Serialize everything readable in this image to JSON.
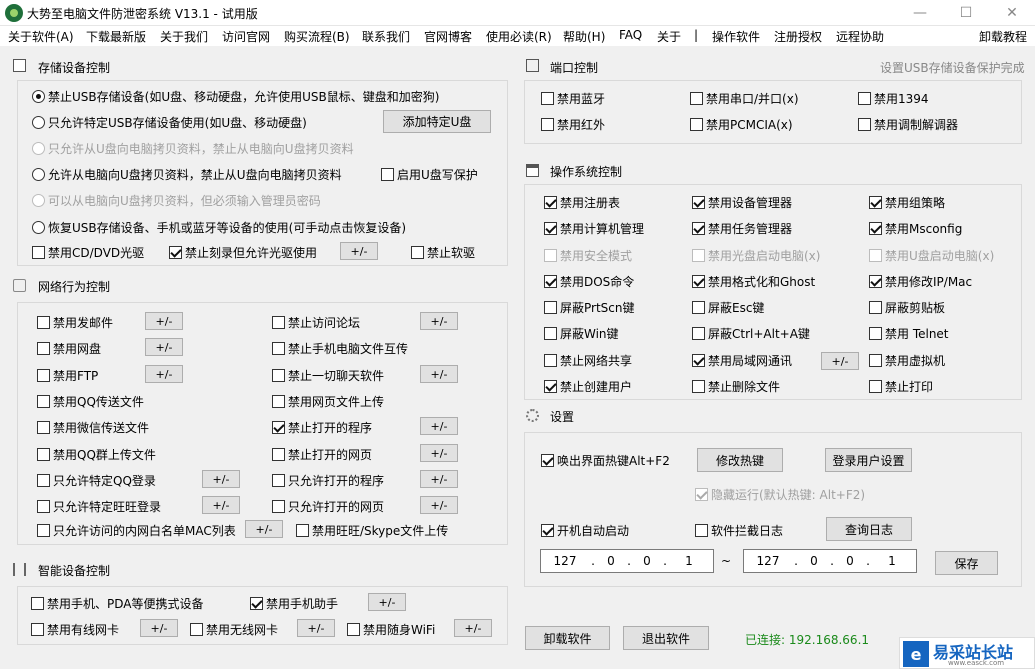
{
  "window": {
    "title": "大势至电脑文件防泄密系统 V13.1 - 试用版",
    "minimize": "—",
    "maximize": "☐",
    "close": "✕"
  },
  "menu": [
    "关于软件(A)",
    "下载最新版",
    "关于我们",
    "访问官网",
    "购买流程(B)",
    "联系我们",
    "官网博客",
    "使用必读(R)",
    "帮助(H)",
    "FAQ",
    "关于",
    "|",
    "操作软件",
    "注册授权",
    "远程协助",
    "卸载教程"
  ],
  "storage": {
    "title": "存储设备控制",
    "radios": [
      {
        "label": "禁止USB存储设备(如U盘、移动硬盘，允许使用USB鼠标、键盘和加密狗)",
        "checked": true,
        "disabled": false
      },
      {
        "label": "只允许特定USB存储设备使用(如U盘、移动硬盘)",
        "checked": false,
        "disabled": false
      },
      {
        "label": "只允许从U盘向电脑拷贝资料，禁止从电脑向U盘拷贝资料",
        "checked": false,
        "disabled": true
      },
      {
        "label": "允许从电脑向U盘拷贝资料，禁止从U盘向电脑拷贝资料",
        "checked": false,
        "disabled": false
      },
      {
        "label": "可以从电脑向U盘拷贝资料，但必须输入管理员密码",
        "checked": false,
        "disabled": true
      },
      {
        "label": "恢复USB存储设备、手机或蓝牙等设备的使用(可手动点击恢复设备)",
        "checked": false,
        "disabled": false
      }
    ],
    "add_usb_button": "添加特定U盘",
    "write_protect": "启用U盘写保护",
    "cd_dvd": "禁用CD/DVD光驱",
    "burn": "禁止刻录但允许光驱使用",
    "floppy": "禁止软驱",
    "pm": "+/-"
  },
  "network": {
    "title": "网络行为控制",
    "left": [
      {
        "label": "禁用发邮件",
        "checked": false,
        "pm": true
      },
      {
        "label": "禁用网盘",
        "checked": false,
        "pm": true
      },
      {
        "label": "禁用FTP",
        "checked": false,
        "pm": true
      },
      {
        "label": "禁用QQ传送文件",
        "checked": false,
        "pm": false
      },
      {
        "label": "禁用微信传送文件",
        "checked": false,
        "pm": false
      },
      {
        "label": "禁用QQ群上传文件",
        "checked": false,
        "pm": false
      },
      {
        "label": "只允许特定QQ登录",
        "checked": false,
        "pm": true
      },
      {
        "label": "只允许特定旺旺登录",
        "checked": false,
        "pm": true
      },
      {
        "label": "只允许访问的内网白名单MAC列表",
        "checked": false,
        "pm": true
      }
    ],
    "right": [
      {
        "label": "禁止访问论坛",
        "checked": false,
        "pm": true
      },
      {
        "label": "禁止手机电脑文件互传",
        "checked": false,
        "pm": false
      },
      {
        "label": "禁止一切聊天软件",
        "checked": false,
        "pm": true
      },
      {
        "label": "禁用网页文件上传",
        "checked": false,
        "pm": false
      },
      {
        "label": "禁止打开的程序",
        "checked": true,
        "pm": true
      },
      {
        "label": "禁止打开的网页",
        "checked": false,
        "pm": true
      },
      {
        "label": "只允许打开的程序",
        "checked": false,
        "pm": true
      },
      {
        "label": "只允许打开的网页",
        "checked": false,
        "pm": true
      },
      {
        "label": "禁用旺旺/Skype文件上传",
        "checked": false,
        "pm": false
      }
    ]
  },
  "smart": {
    "title": "智能设备控制",
    "items": [
      {
        "label": "禁用手机、PDA等便携式设备",
        "checked": false
      },
      {
        "label": "禁用手机助手",
        "checked": true
      },
      {
        "label": "禁用有线网卡",
        "checked": false
      },
      {
        "label": "禁用无线网卡",
        "checked": false
      },
      {
        "label": "禁用随身WiFi",
        "checked": false
      }
    ]
  },
  "port": {
    "title": "端口控制",
    "link": "设置USB存储设备保护完成",
    "items": [
      {
        "label": "禁用蓝牙",
        "checked": false
      },
      {
        "label": "禁用串口/并口(x)",
        "checked": false
      },
      {
        "label": "禁用1394",
        "checked": false
      },
      {
        "label": "禁用红外",
        "checked": false
      },
      {
        "label": "禁用PCMCIA(x)",
        "checked": false
      },
      {
        "label": "禁用调制解调器",
        "checked": false
      }
    ]
  },
  "os": {
    "title": "操作系统控制",
    "items": [
      {
        "label": "禁用注册表",
        "checked": true,
        "disabled": false
      },
      {
        "label": "禁用设备管理器",
        "checked": true,
        "disabled": false
      },
      {
        "label": "禁用组策略",
        "checked": true,
        "disabled": false
      },
      {
        "label": "禁用计算机管理",
        "checked": true,
        "disabled": false
      },
      {
        "label": "禁用任务管理器",
        "checked": true,
        "disabled": false
      },
      {
        "label": "禁用Msconfig",
        "checked": true,
        "disabled": false
      },
      {
        "label": "禁用安全模式",
        "checked": false,
        "disabled": true
      },
      {
        "label": "禁用光盘启动电脑(x)",
        "checked": false,
        "disabled": true
      },
      {
        "label": "禁用U盘启动电脑(x)",
        "checked": false,
        "disabled": true
      },
      {
        "label": "禁用DOS命令",
        "checked": true,
        "disabled": false
      },
      {
        "label": "禁用格式化和Ghost",
        "checked": true,
        "disabled": false
      },
      {
        "label": "禁用修改IP/Mac",
        "checked": true,
        "disabled": false
      },
      {
        "label": "屏蔽PrtScn键",
        "checked": false,
        "disabled": false
      },
      {
        "label": "屏蔽Esc键",
        "checked": false,
        "disabled": false
      },
      {
        "label": "屏蔽剪贴板",
        "checked": false,
        "disabled": false
      },
      {
        "label": "屏蔽Win键",
        "checked": false,
        "disabled": false
      },
      {
        "label": "屏蔽Ctrl+Alt+A键",
        "checked": false,
        "disabled": false
      },
      {
        "label": "禁用 Telnet",
        "checked": false,
        "disabled": false
      },
      {
        "label": "禁止网络共享",
        "checked": false,
        "disabled": false
      },
      {
        "label": "禁用局域网通讯",
        "checked": true,
        "disabled": false
      },
      {
        "label": "禁用虚拟机",
        "checked": false,
        "disabled": false
      },
      {
        "label": "禁止创建用户",
        "checked": true,
        "disabled": false
      },
      {
        "label": "禁止删除文件",
        "checked": false,
        "disabled": false
      },
      {
        "label": "禁止打印",
        "checked": false,
        "disabled": false
      }
    ]
  },
  "settings": {
    "title": "设置",
    "hotkey": "唤出界面热键Alt+F2",
    "modify_hotkey": "修改热键",
    "login_settings": "登录用户设置",
    "hidden_run": "隐藏运行(默认热键: Alt+F2)",
    "autostart": "开机自动启动",
    "intercept_log": "软件拦截日志",
    "query_log": "查询日志",
    "ip_start": [
      "127",
      "0",
      "0",
      "1"
    ],
    "ip_end": [
      "127",
      "0",
      "0",
      "1"
    ],
    "ip_dot": ".",
    "tilde": "~",
    "save": "保存"
  },
  "footer": {
    "uninstall": "卸载软件",
    "exit": "退出软件",
    "connected": "已连接: 192.168.66.1",
    "watermark_main": "易采站长站",
    "watermark_sub": "www.easck.com"
  }
}
